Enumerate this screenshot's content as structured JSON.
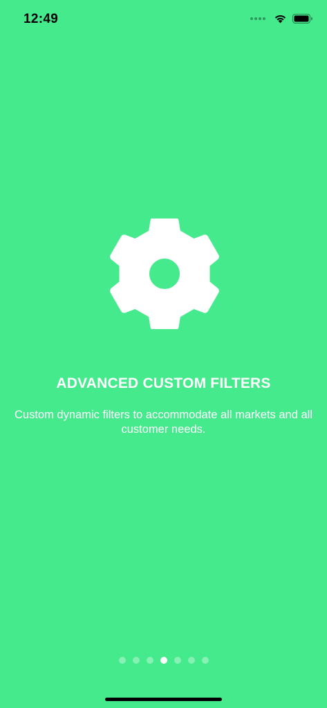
{
  "status_bar": {
    "time": "12:49",
    "icons": [
      "cellular-signal-icon",
      "wifi-icon",
      "battery-icon"
    ]
  },
  "onboarding": {
    "icon": "gear-icon",
    "title": "ADVANCED CUSTOM FILTERS",
    "description": "Custom dynamic filters to accommodate all markets and all customer needs."
  },
  "pagination": {
    "total_pages": 7,
    "current_page": 4
  },
  "colors": {
    "background": "#45EA8C",
    "foreground": "#FFFFFF"
  }
}
